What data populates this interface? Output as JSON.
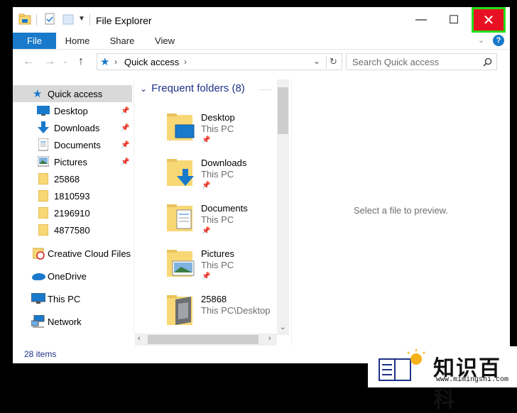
{
  "window": {
    "title": "File Explorer",
    "minimize_glyph": "—",
    "maximize_glyph": "☐",
    "close_glyph": "✕"
  },
  "ribbon": {
    "tabs": [
      {
        "label": "File"
      },
      {
        "label": "Home"
      },
      {
        "label": "Share"
      },
      {
        "label": "View"
      }
    ],
    "help_glyph": "?"
  },
  "address": {
    "path": "Quick access",
    "search_placeholder": "Search Quick access"
  },
  "nav_pane": {
    "quick_access": "Quick access",
    "items": [
      {
        "label": "Desktop",
        "icon": "desktop-icon",
        "pinned": true
      },
      {
        "label": "Downloads",
        "icon": "download-icon",
        "pinned": true
      },
      {
        "label": "Documents",
        "icon": "document-icon",
        "pinned": true
      },
      {
        "label": "Pictures",
        "icon": "pictures-icon",
        "pinned": true
      },
      {
        "label": "25868",
        "icon": "folder-icon",
        "pinned": false
      },
      {
        "label": "1810593",
        "icon": "folder-icon",
        "pinned": false
      },
      {
        "label": "2196910",
        "icon": "folder-icon",
        "pinned": false
      },
      {
        "label": "4877580",
        "icon": "folder-icon",
        "pinned": false
      }
    ],
    "roots": [
      {
        "label": "Creative Cloud Files",
        "icon": "creative-cloud-icon"
      },
      {
        "label": "OneDrive",
        "icon": "onedrive-icon"
      },
      {
        "label": "This PC",
        "icon": "this-pc-icon"
      },
      {
        "label": "Network",
        "icon": "network-icon"
      }
    ]
  },
  "content": {
    "group_header": "Frequent folders (8)",
    "tiles": [
      {
        "name": "Desktop",
        "location": "This PC",
        "pinned": true
      },
      {
        "name": "Downloads",
        "location": "This PC",
        "pinned": true
      },
      {
        "name": "Documents",
        "location": "This PC",
        "pinned": true
      },
      {
        "name": "Pictures",
        "location": "This PC",
        "pinned": true
      },
      {
        "name": "25868",
        "location": "This PC\\Desktop",
        "pinned": false
      }
    ]
  },
  "preview": {
    "message": "Select a file to preview."
  },
  "status_bar": {
    "item_count": "28 items"
  },
  "watermark": {
    "text_cn": "知识百科",
    "url": "www.mimingshi.com"
  },
  "colors": {
    "accent": "#1979ca",
    "close_red": "#e81123",
    "highlight_green": "#22e01a",
    "header_blue": "#1e3287",
    "folder_yellow": "#f8d775"
  }
}
